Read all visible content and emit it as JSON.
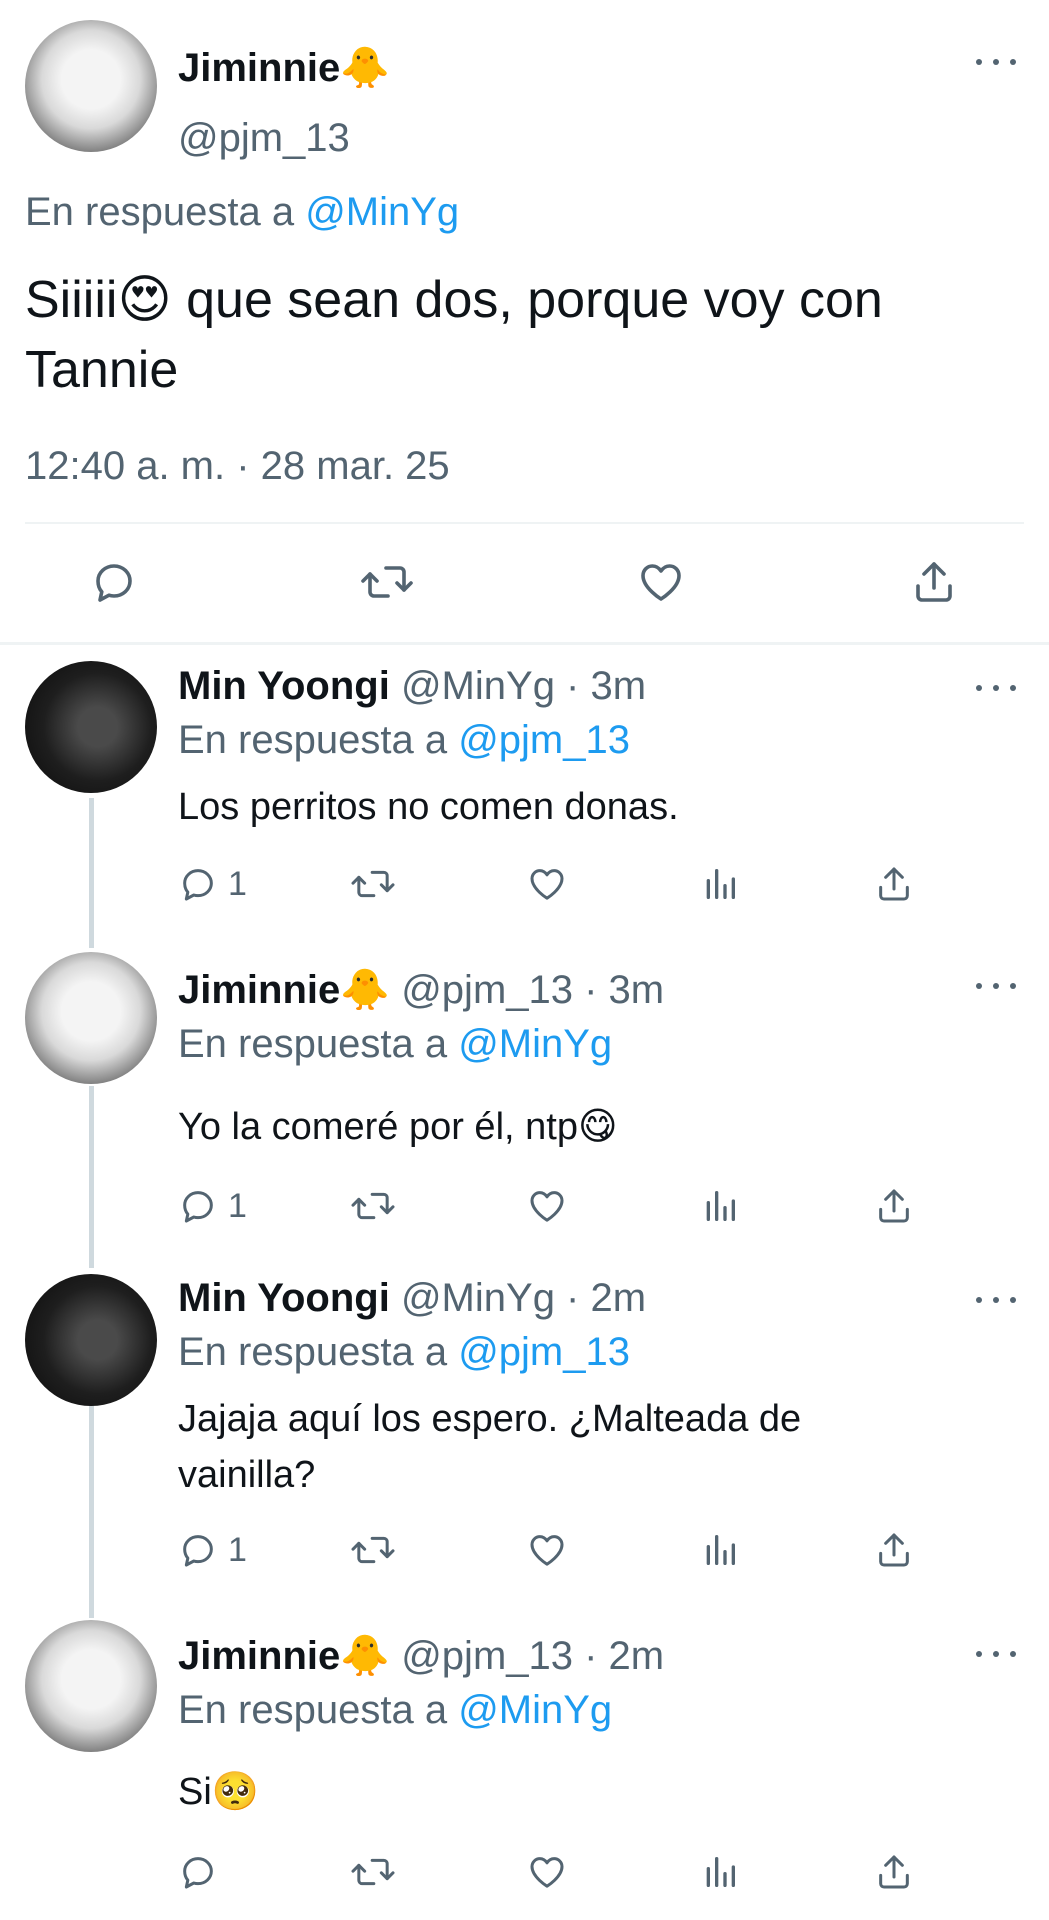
{
  "main_tweet": {
    "author": {
      "name": "Jiminnie🐥",
      "handle": "@pjm_13"
    },
    "reply_prefix": "En respuesta a",
    "reply_to": "@MinYg",
    "text_line1": "Siiiii😍 que sean dos, porque voy con",
    "text_line2": "Tannie",
    "timestamp": "12:40 a. m. · 28 mar. 25"
  },
  "replies": [
    {
      "name": "Min Yoongi",
      "meta": "@MinYg · 3m",
      "reply_prefix": "En respuesta a",
      "reply_to": "@pjm_13",
      "text_line1": "Los perritos no comen donas.",
      "text_line2": "",
      "reply_count": "1"
    },
    {
      "name": "Jiminnie🐥",
      "meta": "@pjm_13 · 3m",
      "reply_prefix": "En respuesta a",
      "reply_to": "@MinYg",
      "text_line1": "Yo la comeré por él, ntp😋",
      "text_line2": "",
      "reply_count": "1"
    },
    {
      "name": "Min Yoongi",
      "meta": "@MinYg · 2m",
      "reply_prefix": "En respuesta a",
      "reply_to": "@pjm_13",
      "text_line1": "Jajaja aquí los espero. ¿Malteada de",
      "text_line2": "vainilla?",
      "reply_count": "1"
    },
    {
      "name": "Jiminnie🐥",
      "meta": "@pjm_13 · 2m",
      "reply_prefix": "En respuesta a",
      "reply_to": "@MinYg",
      "text_line1": "Si🥺",
      "text_line2": "",
      "reply_count": ""
    }
  ],
  "icons": {
    "reply": "reply-icon",
    "retweet": "retweet-icon",
    "like": "heart-icon",
    "views": "views-icon",
    "share": "share-icon",
    "more": "more-icon"
  },
  "colors": {
    "link": "#1d9bf0",
    "secondary": "#536471",
    "divider": "#eff3f4"
  }
}
